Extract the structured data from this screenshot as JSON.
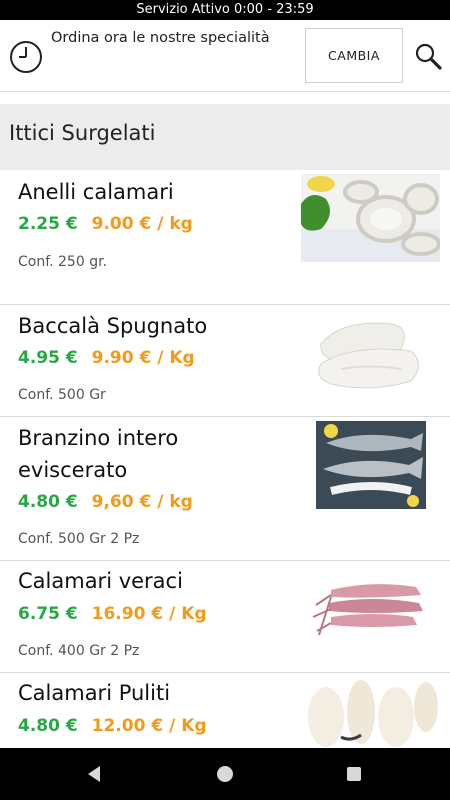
{
  "status_bar": {
    "text": "Servizio Attivo  0:00 - 23:59"
  },
  "header": {
    "message": "Ordina ora le nostre specialità",
    "change_label": "CAMBIA"
  },
  "category": {
    "title": "Ittici Surgelati"
  },
  "colors": {
    "price": "#27a845",
    "unit_price": "#f39a1b",
    "category_bg": "#ececec"
  },
  "products": [
    {
      "name_lines": [
        "Anelli calamari"
      ],
      "price": "2.25 €",
      "unit_price": "9.00 € / kg",
      "conf": "Conf.  250 gr.",
      "image": "squid-rings-photo"
    },
    {
      "name_lines": [
        "Baccalà Spugnato"
      ],
      "price": "4.95 €",
      "unit_price": "9.90 € / Kg",
      "conf": "Conf. 500 Gr",
      "image": "cod-fillet-photo"
    },
    {
      "name_lines": [
        "Branzino intero",
        "eviscerato"
      ],
      "price": "4.80 €",
      "unit_price": "9,60 € / kg",
      "conf": "Conf. 500 Gr 2 Pz",
      "image": "sea-bass-photo"
    },
    {
      "name_lines": [
        "Calamari veraci"
      ],
      "price": "6.75 €",
      "unit_price": "16.90 € / Kg",
      "conf": "Conf. 400 Gr 2 Pz",
      "image": "squid-photo"
    },
    {
      "name_lines": [
        "Calamari Puliti"
      ],
      "price": "4.80 €",
      "unit_price": "12.00 € / Kg",
      "conf": "",
      "image": "clean-squid-photo"
    }
  ],
  "nav": {
    "back": "back-icon",
    "home": "home-icon",
    "recents": "recents-icon"
  }
}
